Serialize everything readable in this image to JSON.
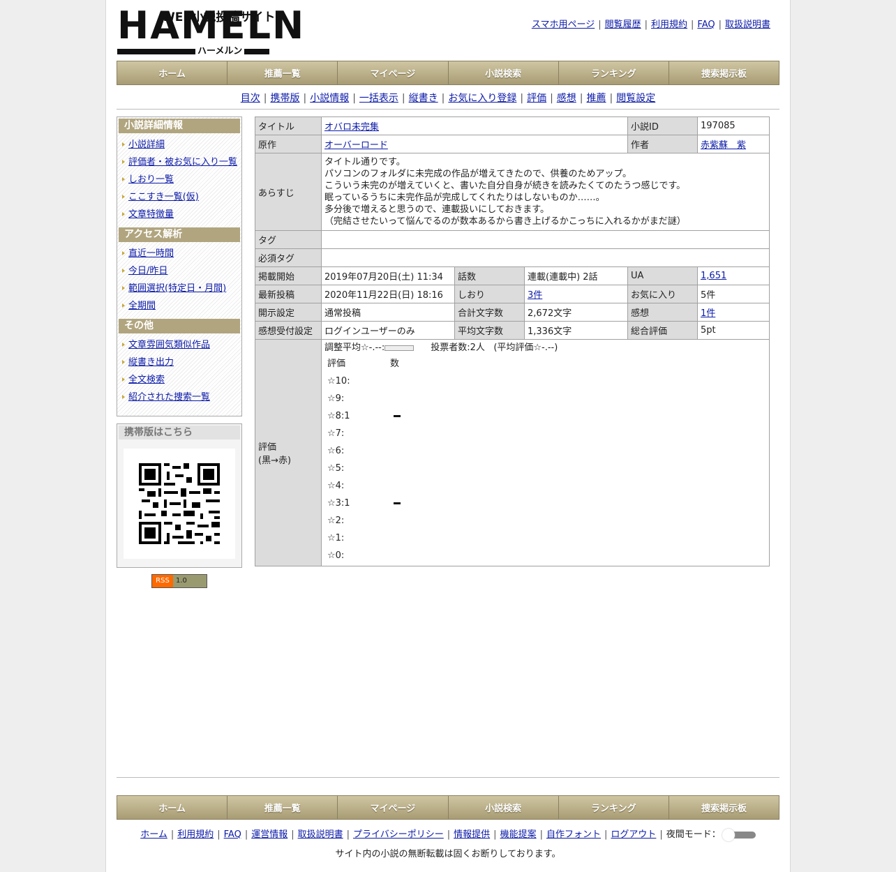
{
  "logo": {
    "word": "HAMELN",
    "tagline": "WEB小説投稿サイト",
    "kana": "ハーメルン"
  },
  "top_links": [
    "スマホ用ページ",
    "閲覧履歴",
    "利用規約",
    "FAQ",
    "取扱説明書"
  ],
  "nav": [
    "ホーム",
    "推薦一覧",
    "マイページ",
    "小説検索",
    "ランキング",
    "捜索掲示板"
  ],
  "sub_nav": [
    "目次",
    "携帯版",
    "小説情報",
    "一括表示",
    "縦書き",
    "お気に入り登録",
    "評価",
    "感想",
    "推薦",
    "閲覧設定"
  ],
  "sidebar": {
    "detail": {
      "title": "小説詳細情報",
      "items": [
        "小説詳細",
        "評価者・被お気に入り一覧",
        "しおり一覧",
        "ここすき一覧(仮)",
        "文章特徴量"
      ]
    },
    "access": {
      "title": "アクセス解析",
      "items": [
        "直近一時間",
        "今日/昨日",
        "範囲選択(特定日・月間)",
        "全期間"
      ]
    },
    "other": {
      "title": "その他",
      "items": [
        "文章雰囲気類似作品",
        "縦書き出力",
        "全文検索",
        "紹介された捜索一覧"
      ]
    },
    "mobile_title": "携帯版はこちら",
    "rss": {
      "left": "RSS",
      "right": "1.0"
    }
  },
  "info": {
    "title_label": "タイトル",
    "title": "オバロ未完集",
    "novel_id_label": "小説ID",
    "novel_id": "197085",
    "original_label": "原作",
    "original": "オーバーロード",
    "author_label": "作者",
    "author": "赤紫蘇　紫",
    "synopsis_label": "あらすじ",
    "synopsis": [
      "タイトル通りです。",
      "パソコンのフォルダに未完成の作品が増えてきたので、供養のためアップ。",
      "こういう未完のが増えていくと、書いた自分自身が続きを読みたくてのたうつ感じです。",
      "眠っているうちに未完作品が完成してくれたりはしないものか……。",
      "多分後で増えると思うので、連載扱いにしておきます。",
      "（完結させたいって悩んでるのが数本あるから書き上げるかこっちに入れるかがまだ謎）"
    ],
    "tag_label": "タグ",
    "required_tag_label": "必須タグ",
    "posted_label": "掲載開始",
    "posted": "2019年07月20日(土) 11:34",
    "episodes_label": "話数",
    "episodes": "連載(連載中) 2話",
    "ua_label": "UA",
    "ua": "1,651",
    "latest_label": "最新投稿",
    "latest": "2020年11月22日(日) 18:16",
    "bookmarks_label": "しおり",
    "bookmarks": "3件",
    "favorites_label": "お気に入り",
    "favorites": "5件",
    "visibility_label": "開示設定",
    "visibility": "通常投稿",
    "total_chars_label": "合計文字数",
    "total_chars": "2,672文字",
    "reviews_label": "感想",
    "reviews": "1件",
    "review_accept_label": "感想受付設定",
    "review_accept": "ログインユーザーのみ",
    "avg_chars_label": "平均文字数",
    "avg_chars": "1,336文字",
    "total_rating_label": "総合評価",
    "total_rating": "5pt",
    "rating_label_1": "評価",
    "rating_label_2": "(黒→赤)"
  },
  "rating": {
    "adjusted_avg": "調整平均☆-.--:",
    "voters": "投票者数:2人",
    "avg": "(平均評価☆-.--)",
    "col_rating": "評価",
    "col_count": "数",
    "rows": [
      {
        "label": "☆10:",
        "count": 0
      },
      {
        "label": "☆9:",
        "count": 0
      },
      {
        "label": "☆8:1",
        "count": 1
      },
      {
        "label": "☆7:",
        "count": 0
      },
      {
        "label": "☆6:",
        "count": 0
      },
      {
        "label": "☆5:",
        "count": 0
      },
      {
        "label": "☆4:",
        "count": 0
      },
      {
        "label": "☆3:1",
        "count": 1
      },
      {
        "label": "☆2:",
        "count": 0
      },
      {
        "label": "☆1:",
        "count": 0
      },
      {
        "label": "☆0:",
        "count": 0
      }
    ]
  },
  "footer": {
    "links": [
      "ホーム",
      "利用規約",
      "FAQ",
      "運営情報",
      "取扱説明書",
      "プライバシーポリシー",
      "情報提供",
      "機能提案",
      "自作フォント",
      "ログアウト"
    ],
    "night_mode": "夜間モード：",
    "notice": "サイト内の小説の無断転載は固くお断りしております。"
  }
}
